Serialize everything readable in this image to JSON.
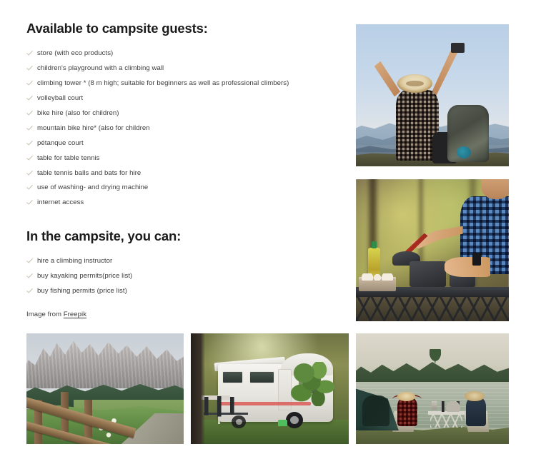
{
  "sections": [
    {
      "heading": "Available to campsite guests:",
      "items": [
        "store (with eco products)",
        "children's playground with a climbing wall",
        "climbing tower * (8 m high; suitable for beginners as well as professional climbers)",
        "volleyball court",
        "bike hire (also for children)",
        "mountain bike hire* (also for children",
        "pétanque court",
        "table for table tennis",
        "table tennis balls and bats for hire",
        "use of washing- and drying machine",
        "internet access"
      ]
    },
    {
      "heading": "In the campsite, you can:",
      "items": [
        "hire a climbing instructor",
        "buy kayaking permits(price list)",
        "buy fishing permits (price list)"
      ]
    }
  ],
  "credit": {
    "prefix": "Image from ",
    "link_label": "Freepik"
  },
  "icons": {
    "check": "check-icon"
  },
  "colors": {
    "heading": "#1b1b1b",
    "body_text": "#3d3d3d",
    "check": "#c9c3b4",
    "background": "#ffffff"
  },
  "images": [
    {
      "name": "hiker-arms-raised-photo",
      "alt": "Hiker with straw hat and backpack raising arms on a mountain ridge"
    },
    {
      "name": "camp-cooking-photo",
      "alt": "Person cooking with pots on a camping table in the forest"
    },
    {
      "name": "mountain-fence-photo",
      "alt": "Wooden fence along a meadow path with dolomite peaks behind"
    },
    {
      "name": "camper-van-photo",
      "alt": "White camper van with awning and chairs parked under trees"
    },
    {
      "name": "lakeside-tent-photo",
      "alt": "Two people relaxing in chairs beside a tent on a lake shore"
    }
  ]
}
